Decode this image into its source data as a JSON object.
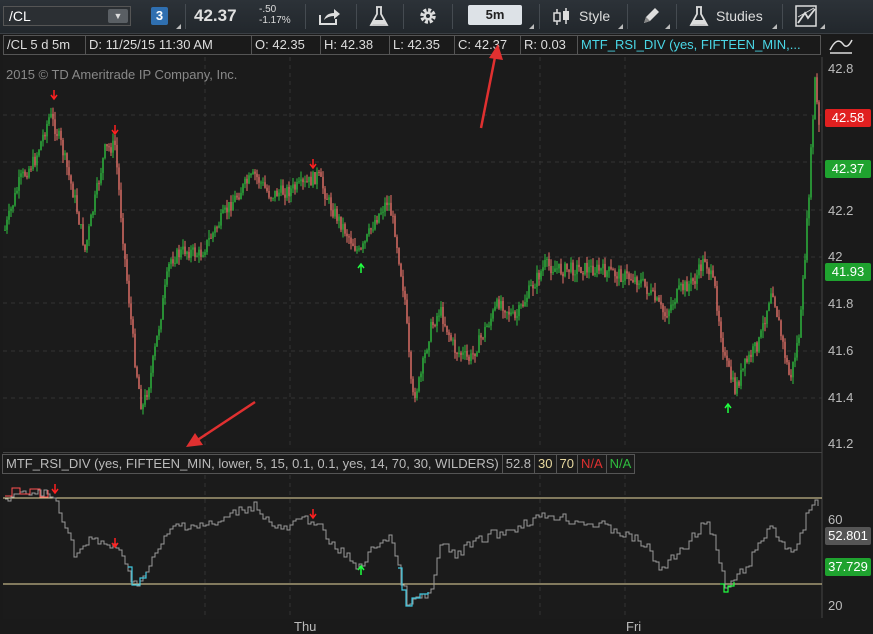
{
  "toolbar": {
    "symbol": "/CL",
    "link_badge": "3",
    "last_price": "42.37",
    "net_change": "-.50",
    "pct_change": "-1.17%",
    "timeframe": "5m",
    "style_label": "Style",
    "studies_label": "Studies"
  },
  "info_bar": {
    "symbol_period": "/CL 5 d 5m",
    "date": "D: 11/25/15 11:30 AM",
    "open": "O: 42.35",
    "high": "H: 42.38",
    "low": "L: 42.35",
    "close": "C: 42.37",
    "range": "R: 0.03",
    "study": "MTF_RSI_DIV (yes, FIFTEEN_MIN,..."
  },
  "copyright": "2015 © TD Ameritrade IP Company, Inc.",
  "price_axis": {
    "ticks": [
      "42.8",
      "42.4",
      "42.2",
      "42",
      "41.8",
      "41.6",
      "41.4",
      "41.2"
    ],
    "tags": [
      {
        "value": "42.58",
        "color": "#e02020"
      },
      {
        "value": "42.37",
        "color": "#1fa32f"
      },
      {
        "value": "41.93",
        "color": "#1fa32f"
      }
    ]
  },
  "lower_study": {
    "title": "MTF_RSI_DIV (yes, FIFTEEN_MIN, lower, 5, 15, 0.1, 0.1, yes, 14, 70, 30, WILDERS)",
    "rsi_value": "52.8",
    "ob": "30",
    "os": "70",
    "na_red": "N/A",
    "na_green": "N/A",
    "axis_ticks": [
      "60",
      "20"
    ],
    "tags": [
      {
        "value": "52.801",
        "color": "#555555"
      },
      {
        "value": "37.729",
        "color": "#1fa32f"
      }
    ]
  },
  "time_axis": [
    "Thu",
    "Fri"
  ],
  "colors": {
    "up_candle": "#2fbf3f",
    "down_candle": "#e8736a",
    "rsi_line": "#9a9a9a",
    "rsi_low": "#3fc8e0",
    "level_line": "#e8d9a0",
    "annotation_arrow": "#e03030"
  }
}
